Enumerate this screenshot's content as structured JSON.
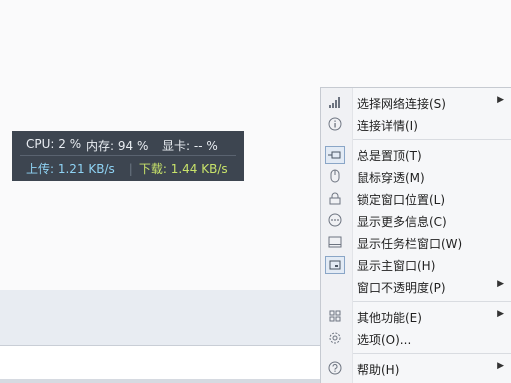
{
  "monitor": {
    "cpu": "CPU: 2 %",
    "mem": "内存: 94 %",
    "gpu": "显卡: -- %",
    "upload": "上传: 1.21 KB/s",
    "divider": "|",
    "download": "下载: 1.44 KB/s"
  },
  "menu": {
    "items": [
      {
        "label": "选择网络连接(S)",
        "icon": "signal-bars-icon",
        "submenu": true
      },
      {
        "label": "连接详情(I)",
        "icon": "info-icon",
        "submenu": false
      },
      {
        "label": "总是置顶(T)",
        "icon": "pin-icon",
        "submenu": false,
        "checked": true
      },
      {
        "label": "鼠标穿透(M)",
        "icon": "mouse-icon",
        "submenu": false
      },
      {
        "label": "锁定窗口位置(L)",
        "icon": "lock-icon",
        "submenu": false
      },
      {
        "label": "显示更多信息(C)",
        "icon": "more-dots-icon",
        "submenu": false
      },
      {
        "label": "显示任务栏窗口(W)",
        "icon": "taskbar-window-icon",
        "submenu": false
      },
      {
        "label": "显示主窗口(H)",
        "icon": "main-window-icon",
        "submenu": false,
        "checked": true
      },
      {
        "label": "窗口不透明度(P)",
        "icon": "",
        "submenu": true
      },
      {
        "label": "其他功能(E)",
        "icon": "grid-icon",
        "submenu": true
      },
      {
        "label": "选项(O)...",
        "icon": "gear-icon",
        "submenu": false
      },
      {
        "label": "帮助(H)",
        "icon": "help-icon",
        "submenu": true
      }
    ],
    "arrow_glyph": "▶"
  }
}
